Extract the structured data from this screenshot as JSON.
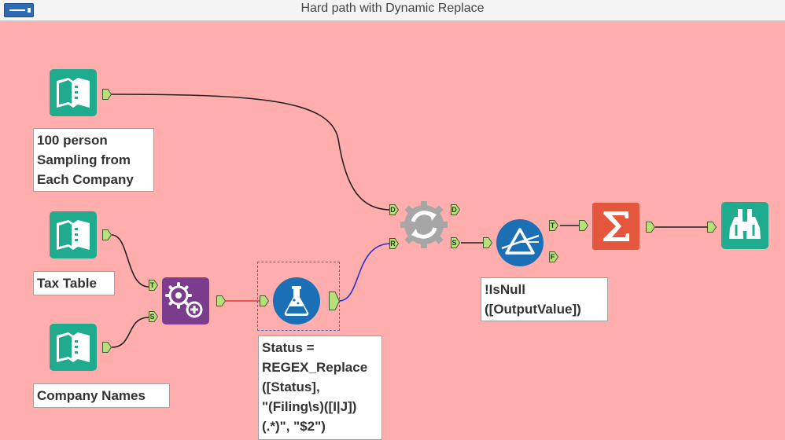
{
  "window": {
    "title": "Hard path with Dynamic Replace"
  },
  "colors": {
    "canvas_background": "#ffadad",
    "input_tool": "#1eab8e",
    "append_fields_tool": "#7c3c8e",
    "formula_tool": "#1b6fb5",
    "dynamic_replace_tool": "#a6a6a6",
    "filter_tool": "#1b6fb5",
    "summarize_tool": "#e4573d",
    "browse_tool": "#1eab8e",
    "anchor": "#b7e07b",
    "connection_default": "#333333",
    "connection_formula": "#e8393a",
    "connection_dynamic": "#2b33c8"
  },
  "tools": {
    "input_sample": {
      "icon": "book-icon",
      "annotation": "100 person\nSampling from\nEach Company"
    },
    "input_tax": {
      "icon": "book-icon",
      "annotation": "Tax Table"
    },
    "input_company": {
      "icon": "book-icon",
      "annotation": "Company Names"
    },
    "append_fields": {
      "icon": "gears-plus-icon"
    },
    "formula": {
      "icon": "flask-icon",
      "annotation": "Status =\nREGEX_Replace\n([Status],\n\"(Filing\\s)([I|J])\n(.*)\", \"$2\")"
    },
    "dynamic_replace": {
      "icon": "recycle-gear-icon"
    },
    "filter": {
      "icon": "filter-prism-icon",
      "annotation": "!IsNull\n([OutputValue])"
    },
    "summarize": {
      "icon": "sigma-icon"
    },
    "browse": {
      "icon": "binoculars-icon"
    }
  },
  "anchors": {
    "append_target": "T",
    "append_source": "S",
    "dynamic_data": "D",
    "dynamic_rules": "R",
    "dynamic_out_d": "D",
    "dynamic_out_s": "S",
    "filter_true": "T",
    "filter_false": "F"
  }
}
